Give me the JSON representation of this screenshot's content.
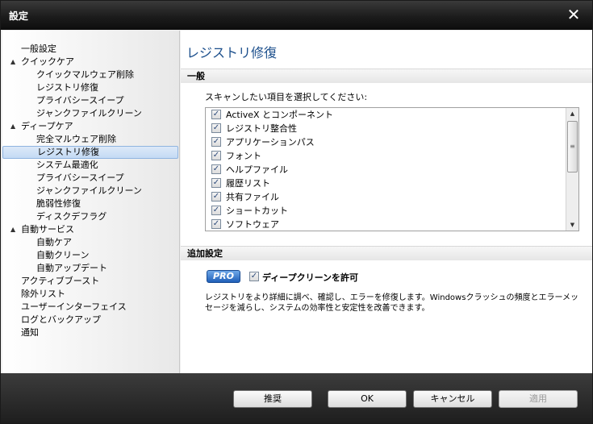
{
  "window": {
    "title": "設定"
  },
  "tree": [
    {
      "label": "一般設定",
      "level": 0,
      "arrow": ""
    },
    {
      "label": "クイックケア",
      "level": 0,
      "arrow": "▲"
    },
    {
      "label": "クイックマルウェア削除",
      "level": 1,
      "arrow": ""
    },
    {
      "label": "レジストリ修復",
      "level": 1,
      "arrow": ""
    },
    {
      "label": "プライバシースイープ",
      "level": 1,
      "arrow": ""
    },
    {
      "label": "ジャンクファイルクリーン",
      "level": 1,
      "arrow": ""
    },
    {
      "label": "ディープケア",
      "level": 0,
      "arrow": "▲"
    },
    {
      "label": "完全マルウェア削除",
      "level": 1,
      "arrow": ""
    },
    {
      "label": "レジストリ修復",
      "level": 1,
      "arrow": "",
      "selected": true
    },
    {
      "label": "システム最適化",
      "level": 1,
      "arrow": ""
    },
    {
      "label": "プライバシースイープ",
      "level": 1,
      "arrow": ""
    },
    {
      "label": "ジャンクファイルクリーン",
      "level": 1,
      "arrow": ""
    },
    {
      "label": "脆弱性修復",
      "level": 1,
      "arrow": ""
    },
    {
      "label": "ディスクデフラグ",
      "level": 1,
      "arrow": ""
    },
    {
      "label": "自動サービス",
      "level": 0,
      "arrow": "▲"
    },
    {
      "label": "自動ケア",
      "level": 1,
      "arrow": ""
    },
    {
      "label": "自動クリーン",
      "level": 1,
      "arrow": ""
    },
    {
      "label": "自動アップデート",
      "level": 1,
      "arrow": ""
    },
    {
      "label": "アクティブブースト",
      "level": 0,
      "arrow": ""
    },
    {
      "label": "除外リスト",
      "level": 0,
      "arrow": ""
    },
    {
      "label": "ユーザーインターフェイス",
      "level": 0,
      "arrow": ""
    },
    {
      "label": "ログとバックアップ",
      "level": 0,
      "arrow": ""
    },
    {
      "label": "通知",
      "level": 0,
      "arrow": ""
    }
  ],
  "content": {
    "heading": "レジストリ修復",
    "general": {
      "section_label": "一般",
      "scan_label": "スキャンしたい項目を選択してください:",
      "items": [
        {
          "label": "ActiveX とコンポーネント",
          "checked": true
        },
        {
          "label": "レジストリ整合性",
          "checked": true
        },
        {
          "label": "アプリケーションパス",
          "checked": true
        },
        {
          "label": "フォント",
          "checked": true
        },
        {
          "label": "ヘルプファイル",
          "checked": true
        },
        {
          "label": "履歴リスト",
          "checked": true
        },
        {
          "label": "共有ファイル",
          "checked": true
        },
        {
          "label": "ショートカット",
          "checked": true
        },
        {
          "label": "ソフトウェア",
          "checked": true
        }
      ]
    },
    "additional": {
      "section_label": "追加設定",
      "pro_badge": "PRO",
      "deep_clean_label": "ディープクリーンを許可",
      "deep_clean_checked": true,
      "description": "レジストリをより詳細に調べ、確認し、エラーを修復します。Windowsクラッシュの頻度とエラーメッセージを減らし、システムの効率性と安定性を改善できます。"
    }
  },
  "footer": {
    "recommend_label": "推奨",
    "ok_label": "OK",
    "cancel_label": "キャンセル",
    "apply_label": "適用"
  },
  "icons": {
    "close": "close-icon",
    "checkmark": "checkmark-icon",
    "expand_arrow": "expand-arrow-icon"
  }
}
